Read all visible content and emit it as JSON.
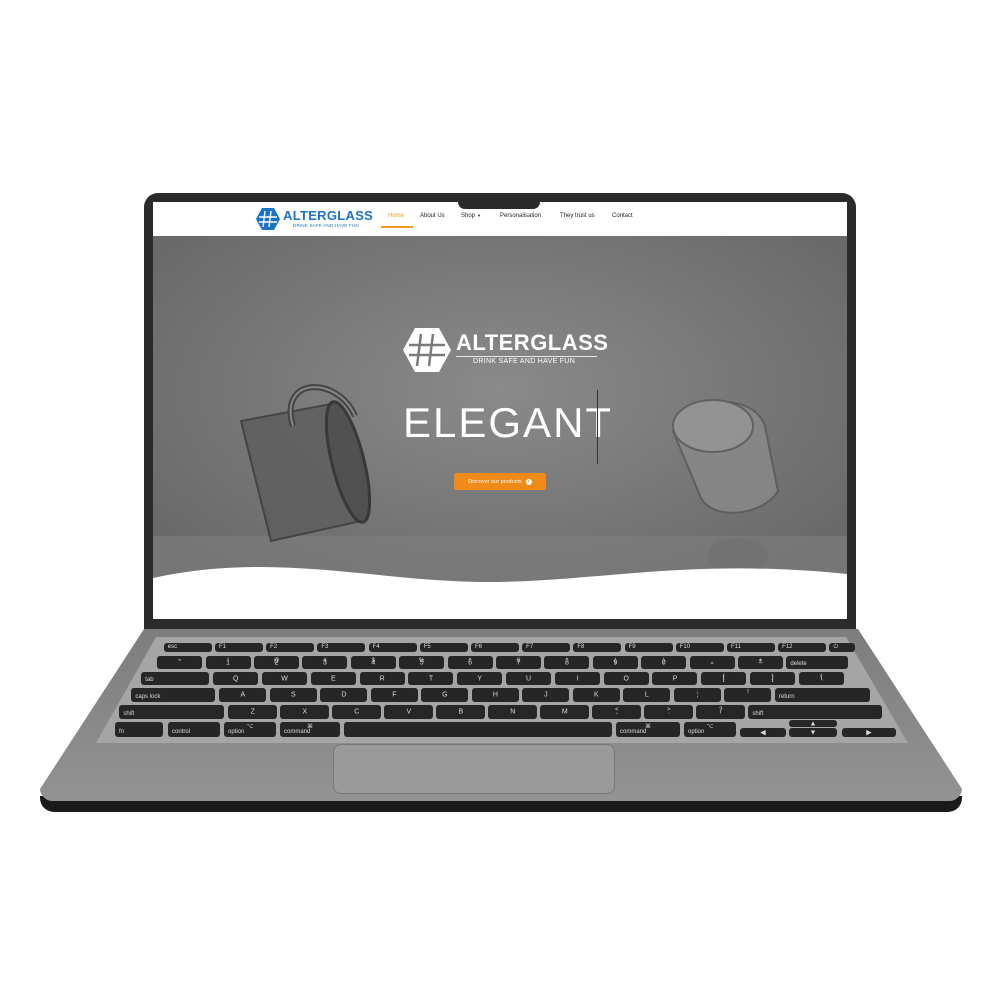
{
  "site": {
    "brand": {
      "name": "ALTERGLASS",
      "tagline": "DRINK SAFE AND HAVE FUN"
    },
    "nav": [
      {
        "label": "Home",
        "active": true
      },
      {
        "label": "About Us",
        "active": false
      },
      {
        "label": "Shop",
        "active": false,
        "has_dropdown": true
      },
      {
        "label": "Personalisation",
        "active": false
      },
      {
        "label": "They trust us",
        "active": false
      },
      {
        "label": "Contact",
        "active": false
      }
    ],
    "hero": {
      "logo_name": "ALTERGLASS",
      "logo_tagline": "DRINK SAFE AND HAVE FUN",
      "headline": "ELEGANT",
      "cta_label": "Discover our products"
    }
  },
  "colors": {
    "brand_blue": "#1a73c9",
    "accent_orange": "#f08a18",
    "nav_active": "#f39b1f",
    "hero_gray": "#767676",
    "laptop_body": "#8e8e8e",
    "key": "#262626"
  },
  "keyboard": {
    "row_fn": [
      "esc",
      "F1",
      "F2",
      "F3",
      "F4",
      "F5",
      "F6",
      "F7",
      "F8",
      "F9",
      "F10",
      "F11",
      "F12",
      "⏻"
    ],
    "row_num": [
      {
        "top": "~",
        "bottom": "`"
      },
      {
        "top": "!",
        "bottom": "1"
      },
      {
        "top": "@",
        "bottom": "2"
      },
      {
        "top": "#",
        "bottom": "3"
      },
      {
        "top": "$",
        "bottom": "4"
      },
      {
        "top": "%",
        "bottom": "5"
      },
      {
        "top": "^",
        "bottom": "6"
      },
      {
        "top": "&",
        "bottom": "7"
      },
      {
        "top": "*",
        "bottom": "8"
      },
      {
        "top": "(",
        "bottom": "9"
      },
      {
        "top": ")",
        "bottom": "0"
      },
      {
        "top": "_",
        "bottom": "-"
      },
      {
        "top": "+",
        "bottom": "="
      }
    ],
    "delete": "delete",
    "tab": "tab",
    "row_q": [
      "Q",
      "W",
      "E",
      "R",
      "T",
      "Y",
      "U",
      "I",
      "O",
      "P"
    ],
    "row_q_sym": [
      {
        "top": "{",
        "bottom": "["
      },
      {
        "top": "}",
        "bottom": "]"
      },
      {
        "top": "|",
        "bottom": "\\"
      }
    ],
    "caps": "caps lock",
    "row_a": [
      "A",
      "S",
      "D",
      "F",
      "G",
      "H",
      "J",
      "K",
      "L"
    ],
    "row_a_sym": [
      {
        "top": ":",
        "bottom": ";"
      },
      {
        "top": "\"",
        "bottom": "'"
      }
    ],
    "return": "return",
    "shift": "shift",
    "row_z": [
      "Z",
      "X",
      "C",
      "V",
      "B",
      "N",
      "M"
    ],
    "row_z_sym": [
      {
        "top": "<",
        "bottom": ","
      },
      {
        "top": ">",
        "bottom": "."
      },
      {
        "top": "?",
        "bottom": "/"
      }
    ],
    "bottom_row": {
      "fn": "fn",
      "control": "control",
      "option": "option",
      "option_symbol": "⌥",
      "command": "command",
      "command_symbol": "⌘",
      "arrow_left": "◀",
      "arrow_up": "▲",
      "arrow_down": "▼",
      "arrow_right": "▶"
    }
  }
}
